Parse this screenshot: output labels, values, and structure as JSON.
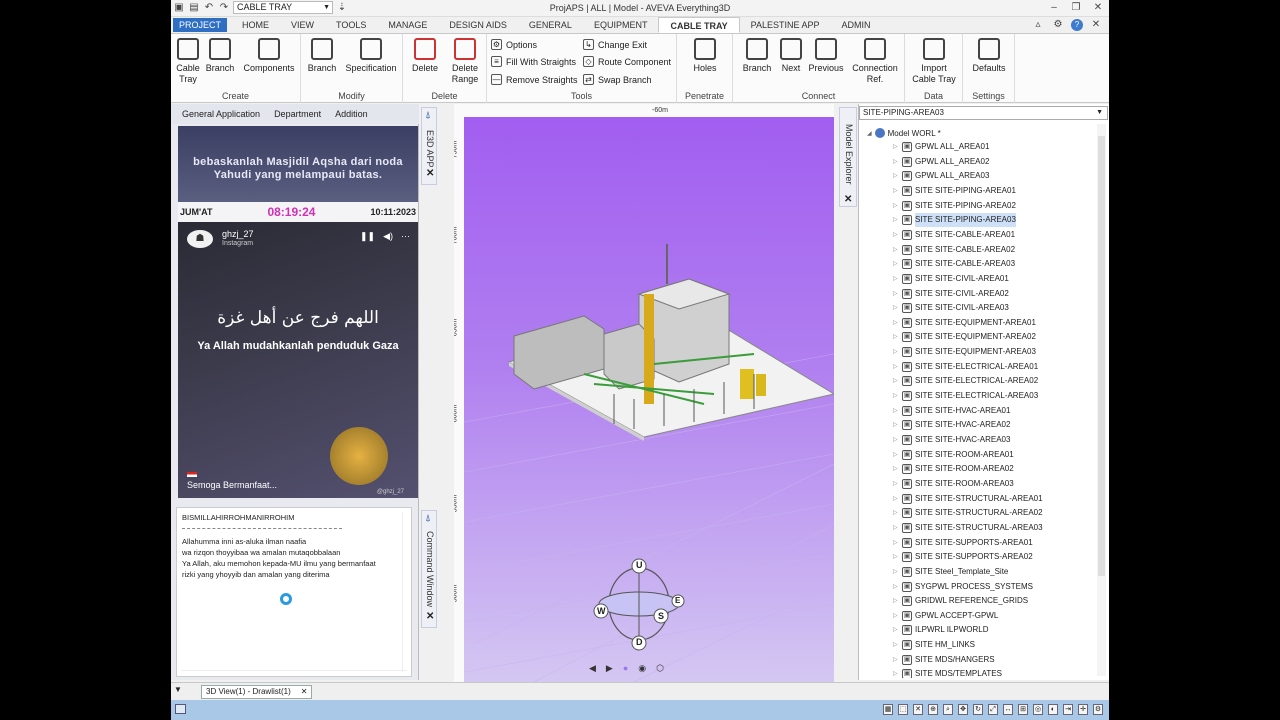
{
  "window": {
    "title": "ProjAPS | ALL | Model - AVEVA Everything3D",
    "combo_value": "CABLE TRAY"
  },
  "tabs": [
    "PROJECT",
    "HOME",
    "VIEW",
    "TOOLS",
    "MANAGE",
    "DESIGN AIDS",
    "GENERAL",
    "EQUIPMENT",
    "CABLE TRAY",
    "PALESTINE APP",
    "ADMIN"
  ],
  "active_tab": "CABLE TRAY",
  "ribbon": {
    "create": {
      "label": "Create",
      "cable_tray": "Cable Tray",
      "branch": "Branch",
      "components": "Components"
    },
    "modify": {
      "label": "Modify",
      "branch": "Branch",
      "specification": "Specification"
    },
    "delete": {
      "label": "Delete",
      "delete": "Delete",
      "delete_range": "Delete Range"
    },
    "tools": {
      "label": "Tools",
      "options": "Options",
      "fill_with_straights": "Fill With Straights",
      "remove_straights": "Remove Straights",
      "change_exit": "Change Exit",
      "route_component": "Route Component",
      "swap_branch": "Swap Branch"
    },
    "penetrate": {
      "label": "Penetrate",
      "holes": "Holes"
    },
    "connect": {
      "label": "Connect",
      "branch": "Branch",
      "next": "Next",
      "previous": "Previous",
      "connection_ref": "Connection Ref."
    },
    "data": {
      "label": "Data",
      "import": "Import Cable Tray"
    },
    "settings": {
      "label": "Settings",
      "defaults": "Defaults"
    }
  },
  "left_panel": {
    "menu": [
      "General Application",
      "Department",
      "Addition"
    ],
    "banner": "bebaskanlah Masjidil Aqsha dari noda Yahudi yang melampaui batas.",
    "day": "JUM'AT",
    "time": "08:19:24",
    "date": "10:11:2023",
    "video": {
      "user": "ghzj_27",
      "platform": "Instagram",
      "arabic": "اللهم فرج عن أهل غزة",
      "caption": "Ya Allah mudahkanlah penduduk Gaza",
      "footer": "Semoga Bermanfaat...",
      "handle": "@ghzj_27"
    },
    "notes": {
      "title": "BISMILLAHIRROHMANIRROHIM",
      "lines": [
        "Allahumma inni as-aluka ilman naafia",
        "wa rizqon thoyyibaa wa amalan mutaqobbalaan",
        "Ya Allah, aku memohon kepada-MU ilmu yang bermanfaat",
        "rizki yang yhoyyib dan amalan yang diterima"
      ]
    }
  },
  "side_strips": {
    "e3d_app": "E3D APP",
    "command_window": "Command Window",
    "model_explorer": "Model Explorer"
  },
  "viewport": {
    "ruler_top": "-60m",
    "ruler_left": [
      "750m",
      "700m",
      "650m",
      "600m",
      "550m",
      "500m"
    ],
    "compass": {
      "up": "U",
      "down": "D",
      "west": "W",
      "south": "S",
      "east": "E"
    }
  },
  "explorer": {
    "header": "SITE-PIPING-AREA03",
    "root": "Model WORL *",
    "items": [
      "GPWL ALL_AREA01",
      "GPWL ALL_AREA02",
      "GPWL ALL_AREA03",
      "SITE SITE-PIPING-AREA01",
      "SITE SITE-PIPING-AREA02",
      "SITE SITE-PIPING-AREA03",
      "SITE SITE-CABLE-AREA01",
      "SITE SITE-CABLE-AREA02",
      "SITE SITE-CABLE-AREA03",
      "SITE SITE-CIVIL-AREA01",
      "SITE SITE-CIVIL-AREA02",
      "SITE SITE-CIVIL-AREA03",
      "SITE SITE-EQUIPMENT-AREA01",
      "SITE SITE-EQUIPMENT-AREA02",
      "SITE SITE-EQUIPMENT-AREA03",
      "SITE SITE-ELECTRICAL-AREA01",
      "SITE SITE-ELECTRICAL-AREA02",
      "SITE SITE-ELECTRICAL-AREA03",
      "SITE SITE-HVAC-AREA01",
      "SITE SITE-HVAC-AREA02",
      "SITE SITE-HVAC-AREA03",
      "SITE SITE-ROOM-AREA01",
      "SITE SITE-ROOM-AREA02",
      "SITE SITE-ROOM-AREA03",
      "SITE SITE-STRUCTURAL-AREA01",
      "SITE SITE-STRUCTURAL-AREA02",
      "SITE SITE-STRUCTURAL-AREA03",
      "SITE SITE-SUPPORTS-AREA01",
      "SITE SITE-SUPPORTS-AREA02",
      "SITE Steel_Template_Site",
      "SYGPWL PROCESS_SYSTEMS",
      "GRIDWL REFERENCE_GRIDS",
      "GPWL ACCEPT-GPWL",
      "ILPWRL ILPWORLD",
      "SITE HM_LINKS",
      "SITE MDS/HANGERS",
      "SITE MDS/TEMPLATES"
    ],
    "selected": "SITE SITE-PIPING-AREA03"
  },
  "bottom": {
    "doc_tab": "3D View(1) - Drawlist(1)",
    "close": "✕"
  },
  "colors": {
    "accent": "#2e6fc4",
    "viewport_top": "#a15cf0",
    "viewport_bottom": "#d4c7f2",
    "time": "#d12fb4",
    "status": "#a9c8e8"
  }
}
